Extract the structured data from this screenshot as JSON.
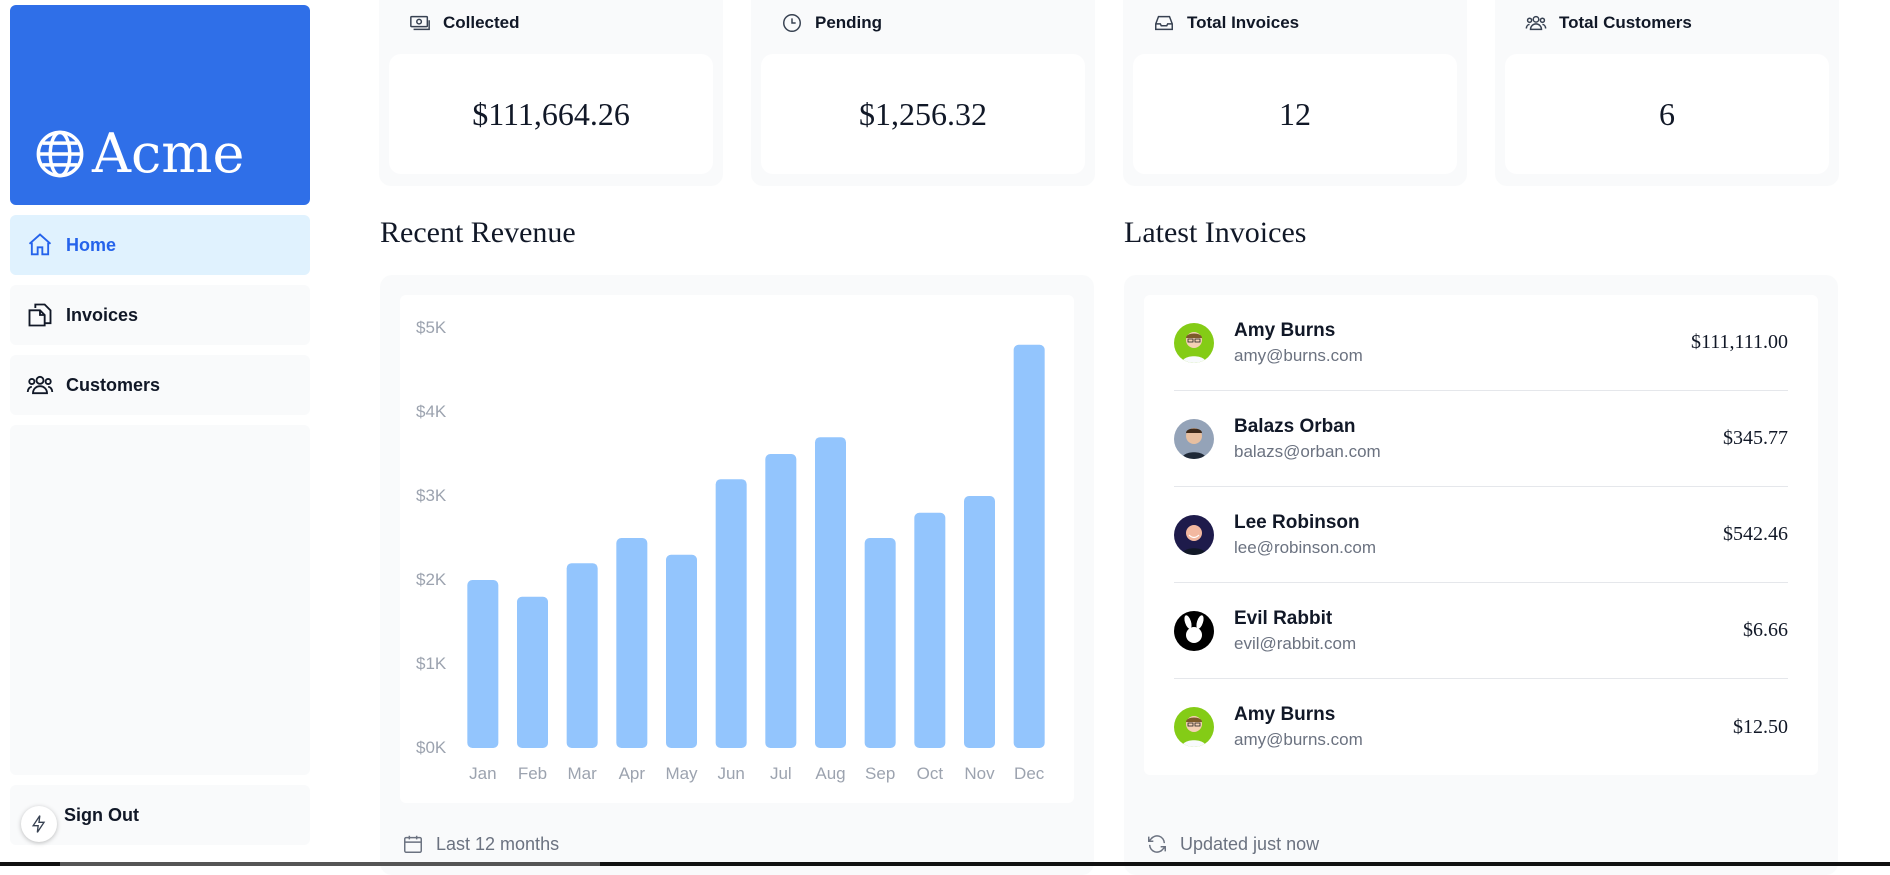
{
  "sidebar": {
    "logo_text": "Acme",
    "nav": [
      {
        "label": "Home",
        "icon": "home-icon",
        "active": true
      },
      {
        "label": "Invoices",
        "icon": "document-duplicate-icon",
        "active": false
      },
      {
        "label": "Customers",
        "icon": "user-group-icon",
        "active": false
      }
    ],
    "signout_label": "Sign Out"
  },
  "cards": [
    {
      "title": "Collected",
      "icon": "banknotes-icon",
      "value": "$111,664.26"
    },
    {
      "title": "Pending",
      "icon": "clock-icon",
      "value": "$1,256.32"
    },
    {
      "title": "Total Invoices",
      "icon": "inbox-icon",
      "value": "12"
    },
    {
      "title": "Total Customers",
      "icon": "user-group-icon",
      "value": "6"
    }
  ],
  "revenue": {
    "title": "Recent Revenue",
    "footer": "Last 12 months"
  },
  "chart_data": {
    "type": "bar",
    "title": "",
    "xlabel": "",
    "ylabel": "",
    "categories": [
      "Jan",
      "Feb",
      "Mar",
      "Apr",
      "May",
      "Jun",
      "Jul",
      "Aug",
      "Sep",
      "Oct",
      "Nov",
      "Dec"
    ],
    "values": [
      2000,
      1800,
      2200,
      2500,
      2300,
      3200,
      3500,
      3700,
      2500,
      2800,
      3000,
      4800
    ],
    "yticks": [
      "$0K",
      "$1K",
      "$2K",
      "$3K",
      "$4K",
      "$5K"
    ],
    "ylim": [
      0,
      5000
    ],
    "grid": false,
    "bar_color": "#93c5fd"
  },
  "invoices": {
    "title": "Latest Invoices",
    "footer": "Updated just now",
    "items": [
      {
        "name": "Amy Burns",
        "email": "amy@burns.com",
        "amount": "$111,111.00",
        "avatar_bg": "#84cc16"
      },
      {
        "name": "Balazs Orban",
        "email": "balazs@orban.com",
        "amount": "$345.77",
        "avatar_bg": "#94a3b8"
      },
      {
        "name": "Lee Robinson",
        "email": "lee@robinson.com",
        "amount": "$542.46",
        "avatar_bg": "#1e1b4b"
      },
      {
        "name": "Evil Rabbit",
        "email": "evil@rabbit.com",
        "amount": "$6.66",
        "avatar_bg": "#000000"
      },
      {
        "name": "Amy Burns",
        "email": "amy@burns.com",
        "amount": "$12.50",
        "avatar_bg": "#84cc16"
      }
    ]
  },
  "colors": {
    "brand": "#2f6fe8",
    "active_nav_bg": "#e0f2fe",
    "active_nav_text": "#2563eb",
    "panel_bg": "#f9fafb"
  }
}
